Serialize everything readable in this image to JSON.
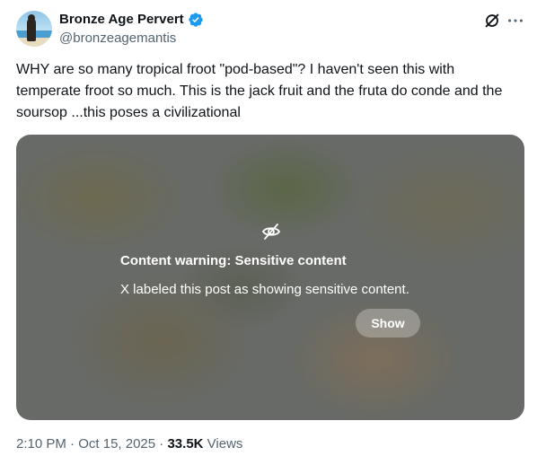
{
  "author": {
    "display_name": "Bronze Age Pervert",
    "handle": "@bronzeagemantis",
    "verified_icon": "verified-badge-icon",
    "verified_color": "#1d9bf0"
  },
  "header_icons": [
    "grok-icon",
    "more-icon"
  ],
  "tweet": {
    "text": "WHY are so many tropical froot \"pod-based\"? I haven't seen this with temperate froot so much. This is the jack fruit and the fruta do conde and the soursop ...this poses a civilizational"
  },
  "media": {
    "warning_icon": "eye-slash-icon",
    "warning_title": "Content warning: Sensitive content",
    "warning_description": "X labeled this post as showing sensitive content.",
    "show_label": "Show"
  },
  "meta": {
    "time": "2:10 PM",
    "sep1": " · ",
    "date": "Oct 15, 2025",
    "sep2": " · ",
    "views_count": "33.5K",
    "views_label": " Views"
  }
}
